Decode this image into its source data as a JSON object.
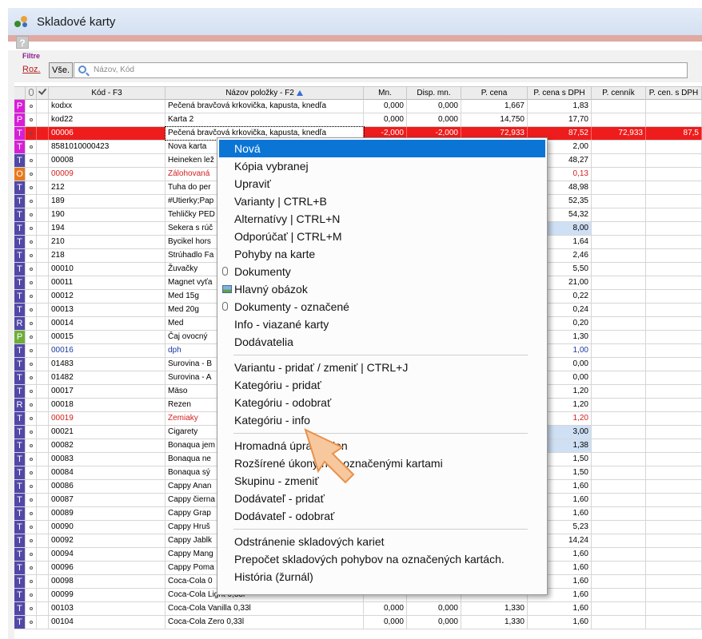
{
  "window": {
    "title": "Skladové karty"
  },
  "filter": {
    "label": "Filtre",
    "roz_label": "Roz.",
    "vse_label": "Vše.",
    "search_placeholder": "Názov, Kód"
  },
  "columns": [
    "",
    "",
    "",
    "Kód - F3",
    "Názov položky - F2",
    "Mn.",
    "Disp. mn.",
    "P. cena",
    "P. cena s DPH",
    "P. cenník",
    "P. cen. s DPH"
  ],
  "rows": [
    {
      "type": "P",
      "color": "#d81fd8",
      "code": "kodxx",
      "name": "Pečená bravčová krkovička, kapusta, knedľa",
      "mn": "0,000",
      "disp": "0,000",
      "pcena": "1,667",
      "pdph": "1,83"
    },
    {
      "type": "P",
      "color": "#d81fd8",
      "code": "kod22",
      "name": "Karta 2",
      "mn": "0,000",
      "disp": "0,000",
      "pcena": "14,750",
      "pdph": "17,70"
    },
    {
      "type": "T",
      "color": "#d81fd8",
      "code": "00006",
      "name": "Pečená bravčová krkovička, kapusta, knedľa",
      "mn": "-2,000",
      "disp": "-2,000",
      "pcena": "72,933",
      "pdph": "87,52",
      "pcennik": "72,933",
      "pcendph": "87,5",
      "selected": true
    },
    {
      "type": "T",
      "color": "#d81fd8",
      "code": "8581010000423",
      "name": "Nova karta",
      "pdph": "2,00"
    },
    {
      "type": "T",
      "color": "#5248a8",
      "code": "00008",
      "name": "Heineken lež",
      "pdph": "48,27"
    },
    {
      "type": "O",
      "color": "#e87a1c",
      "code": "00009",
      "name": "Zálohovaná",
      "pdph": "0,13",
      "red": true
    },
    {
      "type": "T",
      "color": "#5248a8",
      "code": "212",
      "name": "Tuha do per",
      "pdph": "48,98"
    },
    {
      "type": "T",
      "color": "#5248a8",
      "code": "189",
      "name": "#Utierky;Pap",
      "pdph": "52,35"
    },
    {
      "type": "T",
      "color": "#5248a8",
      "code": "190",
      "name": "Tehličky PED",
      "pdph": "54,32"
    },
    {
      "type": "T",
      "color": "#5248a8",
      "code": "194",
      "name": "Sekera s rúč",
      "pdph": "8,00",
      "blue": true
    },
    {
      "type": "T",
      "color": "#5248a8",
      "code": "210",
      "name": "Bycikel hors",
      "pdph": "1,64"
    },
    {
      "type": "T",
      "color": "#5248a8",
      "code": "218",
      "name": "Strúhadlo Fa",
      "pdph": "2,46"
    },
    {
      "type": "T",
      "color": "#5248a8",
      "code": "00010",
      "name": "Žuvačky",
      "pdph": "5,50"
    },
    {
      "type": "T",
      "color": "#5248a8",
      "code": "00011",
      "name": "Magnet vyťa",
      "pdph": "21,00"
    },
    {
      "type": "T",
      "color": "#5248a8",
      "code": "00012",
      "name": "Med 15g",
      "pdph": "0,22"
    },
    {
      "type": "T",
      "color": "#5248a8",
      "code": "00013",
      "name": "Med 20g",
      "pdph": "0,24"
    },
    {
      "type": "R",
      "color": "#5248a8",
      "code": "00014",
      "name": "Med",
      "pdph": "0,20"
    },
    {
      "type": "P",
      "color": "#6fae3a",
      "code": "00015",
      "name": "Čaj ovocný",
      "pdph": "1,30"
    },
    {
      "type": "T",
      "color": "#5248a8",
      "code": "00016",
      "name": "dph",
      "pdph": "1,00",
      "bluetext": true
    },
    {
      "type": "T",
      "color": "#5248a8",
      "code": "01483",
      "name": "Surovina - B",
      "pdph": "0,00"
    },
    {
      "type": "T",
      "color": "#5248a8",
      "code": "01482",
      "name": "Surovina - A",
      "pdph": "0,00"
    },
    {
      "type": "T",
      "color": "#5248a8",
      "code": "00017",
      "name": "Mäso",
      "pdph": "1,20"
    },
    {
      "type": "R",
      "color": "#5248a8",
      "code": "00018",
      "name": "Rezen",
      "pdph": "1,20"
    },
    {
      "type": "T",
      "color": "#5248a8",
      "code": "00019",
      "name": "Zemiaky",
      "pdph": "1,20",
      "red": true
    },
    {
      "type": "T",
      "color": "#5248a8",
      "code": "00021",
      "name": "Cigarety",
      "pdph": "3,00",
      "blue": true
    },
    {
      "type": "T",
      "color": "#5248a8",
      "code": "00082",
      "name": "Bonaqua jem",
      "pdph": "1,38",
      "blue": true
    },
    {
      "type": "T",
      "color": "#5248a8",
      "code": "00083",
      "name": "Bonaqua ne",
      "pdph": "1,50"
    },
    {
      "type": "T",
      "color": "#5248a8",
      "code": "00084",
      "name": "Bonaqua sý",
      "pdph": "1,50"
    },
    {
      "type": "T",
      "color": "#5248a8",
      "code": "00086",
      "name": "Cappy Anan",
      "pdph": "1,60"
    },
    {
      "type": "T",
      "color": "#5248a8",
      "code": "00087",
      "name": "Cappy čierna",
      "pdph": "1,60"
    },
    {
      "type": "T",
      "color": "#5248a8",
      "code": "00089",
      "name": "Cappy Grap",
      "pdph": "1,60"
    },
    {
      "type": "T",
      "color": "#5248a8",
      "code": "00090",
      "name": "Cappy Hruš",
      "pdph": "5,23"
    },
    {
      "type": "T",
      "color": "#5248a8",
      "code": "00092",
      "name": "Cappy Jablk",
      "pdph": "14,24"
    },
    {
      "type": "T",
      "color": "#5248a8",
      "code": "00094",
      "name": "Cappy Mang",
      "pdph": "1,60"
    },
    {
      "type": "T",
      "color": "#5248a8",
      "code": "00096",
      "name": "Cappy Poma",
      "pdph": "1,60"
    },
    {
      "type": "T",
      "color": "#5248a8",
      "code": "00098",
      "name": "Coca-Cola 0",
      "pdph": "1,60"
    },
    {
      "type": "T",
      "color": "#5248a8",
      "code": "00099",
      "name": "Coca-Cola Light 0,33l",
      "pdph": "1,60"
    },
    {
      "type": "T",
      "color": "#5248a8",
      "code": "00103",
      "name": "Coca-Cola Vanilla 0,33l",
      "mn": "0,000",
      "disp": "0,000",
      "pcena": "1,330",
      "pdph": "1,60"
    },
    {
      "type": "T",
      "color": "#5248a8",
      "code": "00104",
      "name": "Coca-Cola Zero 0,33l",
      "mn": "0,000",
      "disp": "0,000",
      "pcena": "1,330",
      "pdph": "1,60"
    }
  ],
  "context_menu": {
    "items": [
      {
        "label": "Nová",
        "highlight": true
      },
      {
        "label": "Kópia vybranej"
      },
      {
        "label": "Upraviť"
      },
      {
        "label": "Varianty | CTRL+B"
      },
      {
        "label": "Alternatívy | CTRL+N"
      },
      {
        "label": "Odporúčať | CTRL+M"
      },
      {
        "label": "Pohyby na karte"
      },
      {
        "label": "Dokumenty",
        "icon": "paperclip-icon"
      },
      {
        "label": "Hlavný obázok",
        "icon": "image-icon"
      },
      {
        "label": "Dokumenty - označené",
        "icon": "paperclip-icon"
      },
      {
        "label": "Info - viazané karty"
      },
      {
        "label": "Dodávatelia"
      },
      {
        "sep": true
      },
      {
        "label": "Variantu - pridať / zmeniť | CTRL+J"
      },
      {
        "label": "Kategóriu - pridať"
      },
      {
        "label": "Kategóriu - odobrať"
      },
      {
        "label": "Kategóriu - info"
      },
      {
        "sep": true
      },
      {
        "label": "Hromadná úprava cien"
      },
      {
        "label": "Rozšírené úkony nad označenými kartami"
      },
      {
        "label": "Skupinu - zmeniť"
      },
      {
        "label": "Dodávateľ - pridať"
      },
      {
        "label": "Dodávateľ - odobrať"
      },
      {
        "sep": true
      },
      {
        "label": "Odstránenie skladových kariet"
      },
      {
        "label": "Prepočet skladových pohybov na označených kartách."
      },
      {
        "label": "História (žurnál)"
      }
    ]
  },
  "colors": {
    "selected_row": "#ee1c1c",
    "menu_highlight": "#0b75d6",
    "arrow_fill": "#f7c79e",
    "arrow_stroke": "#e8914a"
  }
}
